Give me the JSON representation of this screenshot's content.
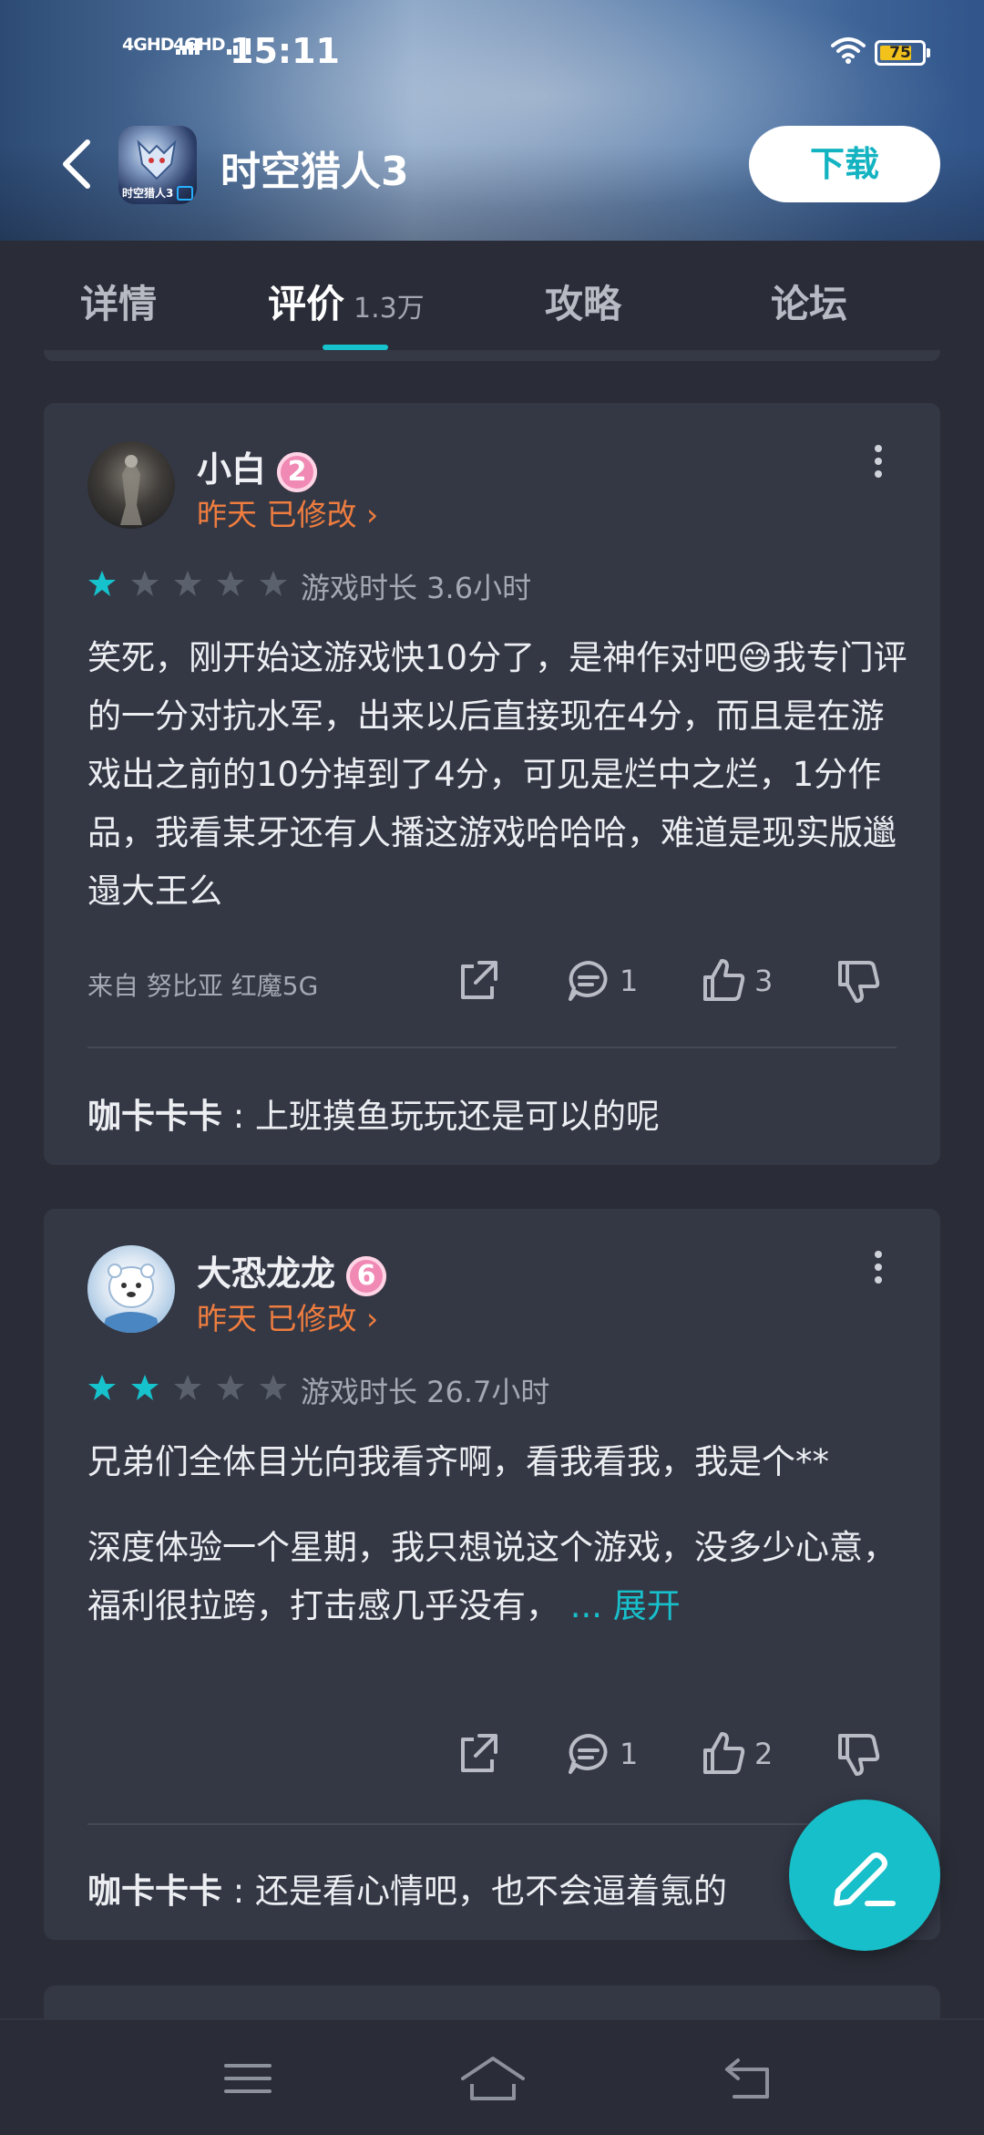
{
  "status_bar": {
    "signal1": "4GHD",
    "signal2": "4GHD",
    "time": "15:11",
    "battery": "75"
  },
  "header": {
    "app_icon_label": "时空猎人3",
    "title": "时空猎人3",
    "download_label": "下载"
  },
  "tabs": [
    {
      "label": "详情"
    },
    {
      "label": "评价",
      "count": "1.3万"
    },
    {
      "label": "攻略"
    },
    {
      "label": "论坛"
    }
  ],
  "reviews": [
    {
      "username": "小白",
      "level": "2",
      "date": "昨天",
      "edited": "已修改 ›",
      "rating": 1,
      "playtime": "游戏时长 3.6小时",
      "text": "笑死，刚开始这游戏快10分了，是神作对吧😅我专门评的一分对抗水军，出来以后直接现在4分，而且是在游戏出之前的10分掉到了4分，可见是烂中之烂，1分作品，我看某牙还有人播这游戏哈哈哈，难道是现实版邋遢大王么",
      "source": "来自 努比亚 红魔5G",
      "comments": "1",
      "likes": "3",
      "reply_user": "咖卡卡卡",
      "reply_text": "上班摸鱼玩玩还是可以的呢"
    },
    {
      "username": "大恐龙龙",
      "level": "6",
      "date": "昨天",
      "edited": "已修改 ›",
      "rating": 2,
      "playtime": "游戏时长 26.7小时",
      "text_line1": "兄弟们全体目光向我看齐啊，看我看我，我是个**",
      "text_line2": "深度体验一个星期，我只想说这个游戏，没多少心意，福利很拉跨，打击感几乎没有，",
      "expand": "... 展开",
      "comments": "1",
      "likes": "2",
      "reply_user": "咖卡卡卡",
      "reply_text": "还是看心情吧，也不会逼着氪的"
    }
  ],
  "colors": {
    "accent": "#16c3cd",
    "orange": "#ef7d3f",
    "card_bg": "#343845",
    "page_bg": "#2a2d37"
  },
  "icons": {
    "back": "chevron-left-icon",
    "share": "share-icon",
    "comment": "comment-icon",
    "like": "thumbs-up-icon",
    "dislike": "thumbs-down-icon",
    "more": "more-vertical-icon",
    "fab": "edit-pen-icon",
    "nav_menu": "menu-icon",
    "nav_home": "home-icon",
    "nav_back": "back-icon"
  }
}
